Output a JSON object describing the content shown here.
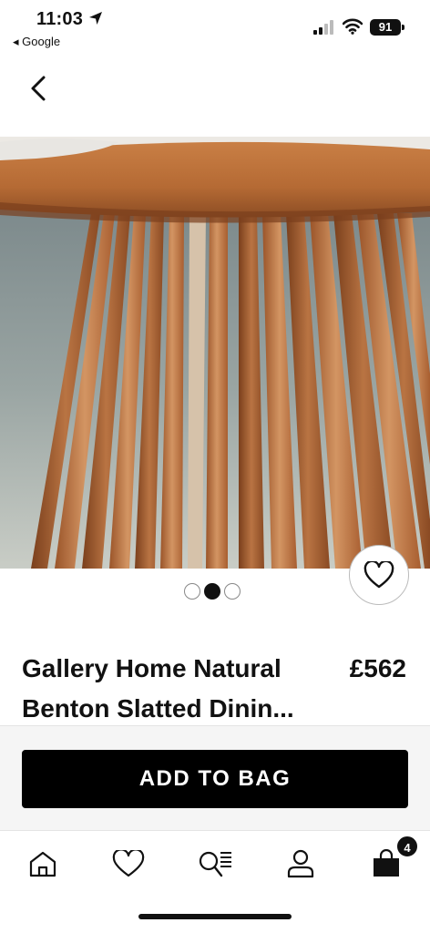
{
  "status_bar": {
    "time": "11:03",
    "back_app": "◂ Google",
    "battery": "91"
  },
  "product": {
    "title_line1": "Gallery Home Natural",
    "title_line2": "Benton Slatted Dinin...",
    "price": "£562",
    "image_alt": "Wooden slatted pedestal table base"
  },
  "carousel": {
    "total": 3,
    "active_index": 1
  },
  "actions": {
    "add_to_bag": "ADD TO BAG"
  },
  "tab_bar": {
    "items": [
      "home-icon",
      "heart-icon",
      "search-list-icon",
      "account-icon",
      "bag-icon"
    ],
    "bag_count": "4"
  },
  "colors": {
    "button_bg": "#000000",
    "wood": "#b5652f",
    "background": "#ffffff"
  }
}
